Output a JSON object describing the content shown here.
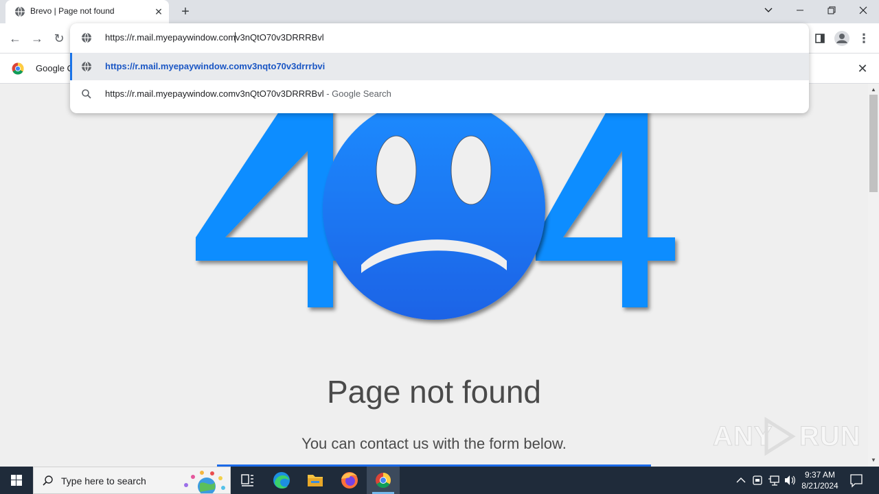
{
  "browser": {
    "tab_title": "Brevo | Page not found",
    "tab_close": "✕",
    "new_tab": "+",
    "window_controls": {
      "minimize": "—",
      "restore": "❐",
      "close": "✕",
      "tab_search": "⌄"
    }
  },
  "toolbar": {
    "back": "←",
    "forward": "→",
    "reload": "↻",
    "menu": "⋮"
  },
  "omnibox": {
    "input_before_caret": "https://r.mail.myepaywindow.com",
    "input_after_caret": "v3nQtO70v3DRRRBvl",
    "suggestions": [
      {
        "text": "https://r.mail.myepaywindow.comv3nqto70v3drrrbvi",
        "icon": "globe-icon"
      },
      {
        "text": "https://r.mail.myepaywindow.comv3nQtO70v3DRRRBvl",
        "suffix": " - Google Search",
        "icon": "search-icon"
      }
    ]
  },
  "infobar": {
    "text": "Google C",
    "close": "✕"
  },
  "page": {
    "title": "Page not found",
    "subtitle": "You can contact us with the form below.",
    "colors": {
      "accent": "#1b6ae8",
      "bright": "#0a8dff"
    }
  },
  "watermark": {
    "left": "ANY",
    "right": "RUN"
  },
  "taskbar": {
    "search_placeholder": "Type here to search",
    "time": "9:37 AM",
    "date": "8/21/2024",
    "apps": [
      "task-view",
      "edge",
      "file-explorer",
      "firefox",
      "chrome"
    ]
  }
}
